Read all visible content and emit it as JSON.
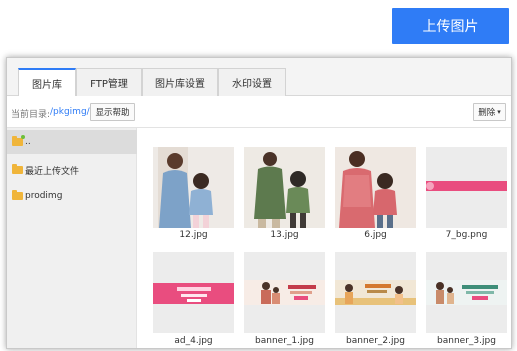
{
  "upload_button": "上传图片",
  "tabs": [
    "图片库",
    "FTP管理",
    "图片库设置",
    "水印设置"
  ],
  "toolbar": {
    "path_label": "当前目录:",
    "path_value": "/pkgimg/",
    "help_button": "显示帮助",
    "delete_button": "删除",
    "delete_caret": "▾"
  },
  "sidebar": {
    "items": [
      "..",
      "最近上传文件",
      "prodimg"
    ]
  },
  "files": [
    {
      "name": "12.jpg"
    },
    {
      "name": "13.jpg"
    },
    {
      "name": "6.jpg"
    },
    {
      "name": "7_bg.png"
    },
    {
      "name": "ad_4.jpg"
    },
    {
      "name": "banner_1.jpg"
    },
    {
      "name": "banner_2.jpg"
    },
    {
      "name": "banner_3.jpg"
    }
  ],
  "colors": {
    "accent": "#2f7cf6",
    "folder": "#f0b53a",
    "banner_pink": "#e94d7f"
  }
}
